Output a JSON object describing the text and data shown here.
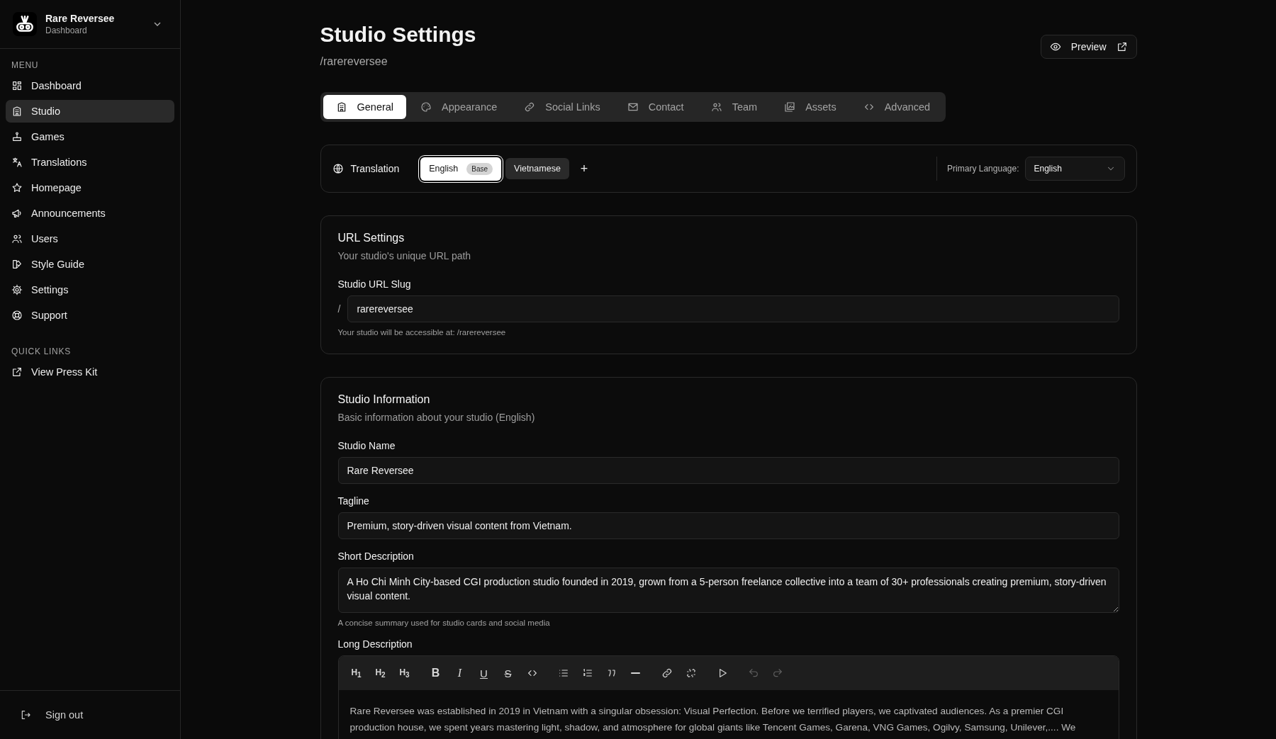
{
  "sidebar": {
    "org": {
      "name": "Rare Reversee",
      "subtitle": "Dashboard"
    },
    "menu_heading": "MENU",
    "menu": [
      {
        "label": "Dashboard",
        "selected": false
      },
      {
        "label": "Studio",
        "selected": true
      },
      {
        "label": "Games",
        "selected": false
      },
      {
        "label": "Translations",
        "selected": false
      },
      {
        "label": "Homepage",
        "selected": false
      },
      {
        "label": "Announcements",
        "selected": false
      },
      {
        "label": "Users",
        "selected": false
      },
      {
        "label": "Style Guide",
        "selected": false
      },
      {
        "label": "Settings",
        "selected": false
      },
      {
        "label": "Support",
        "selected": false
      }
    ],
    "quick_links_heading": "QUICK LINKS",
    "quick_links": [
      {
        "label": "View Press Kit"
      }
    ],
    "sign_out": "Sign out"
  },
  "header": {
    "title": "Studio Settings",
    "subtitle": "/rarereversee",
    "preview_button": "Preview"
  },
  "tabs": [
    {
      "label": "General",
      "selected": true
    },
    {
      "label": "Appearance",
      "selected": false
    },
    {
      "label": "Social Links",
      "selected": false
    },
    {
      "label": "Contact",
      "selected": false
    },
    {
      "label": "Team",
      "selected": false
    },
    {
      "label": "Assets",
      "selected": false
    },
    {
      "label": "Advanced",
      "selected": false
    }
  ],
  "translation": {
    "label": "Translation",
    "languages": [
      {
        "label": "English",
        "badge": "Base",
        "selected": true
      },
      {
        "label": "Vietnamese",
        "selected": false
      }
    ],
    "add": "+",
    "primary_label": "Primary Language:",
    "primary_value": "English"
  },
  "url_settings": {
    "title": "URL Settings",
    "description": "Your studio's unique URL path",
    "field_label": "Studio URL Slug",
    "prefix": "/",
    "value": "rarereversee",
    "hint": "Your studio will be accessible at: /rarereversee"
  },
  "studio_information": {
    "title": "Studio Information",
    "description": "Basic information about your studio (English)",
    "fields": [
      {
        "kind": "input",
        "label": "Studio Name",
        "value": "Rare Reversee"
      },
      {
        "kind": "input",
        "label": "Tagline",
        "value": "Premium, story-driven visual content from Vietnam."
      },
      {
        "kind": "textarea",
        "label": "Short Description",
        "value": "A Ho Chi Minh City-based CGI production studio founded in 2019, grown from a 5-person freelance collective into a team of 30+ professionals creating premium, story-driven visual content.",
        "hint": "A concise summary used for studio cards and social media"
      },
      {
        "kind": "editor",
        "label": "Long Description",
        "toolbar": [
          {
            "kind": "heading",
            "label": "H$_{1}$"
          },
          {
            "kind": "heading",
            "label": "H$_{2}$"
          },
          {
            "kind": "heading",
            "label": "H$_{3}$"
          },
          {
            "kind": "bold",
            "label": "B"
          },
          {
            "kind": "italic",
            "label": "I"
          },
          {
            "kind": "underline",
            "label": "U"
          },
          {
            "kind": "strike",
            "label": "S"
          },
          {
            "kind": "code"
          },
          {
            "kind": "bullet-list"
          },
          {
            "kind": "ordered-list"
          },
          {
            "kind": "quote"
          },
          {
            "kind": "rule"
          },
          {
            "kind": "link"
          },
          {
            "kind": "unlink"
          },
          {
            "kind": "media"
          },
          {
            "kind": "undo",
            "disabled": true
          },
          {
            "kind": "redo",
            "disabled": true
          }
        ],
        "lines": [
          "Rare Reversee was established in 2019 in Vietnam with a singular obsession: Visual Perfection. Before we terrified players, we captivated audiences. As a premier CGI",
          "production house, we spent years mastering light, shadow, and atmosphere for global giants like Tencent Games, Garena, VNG Games, Ogilvy, Samsung, Unilever,.... We"
        ]
      }
    ]
  }
}
